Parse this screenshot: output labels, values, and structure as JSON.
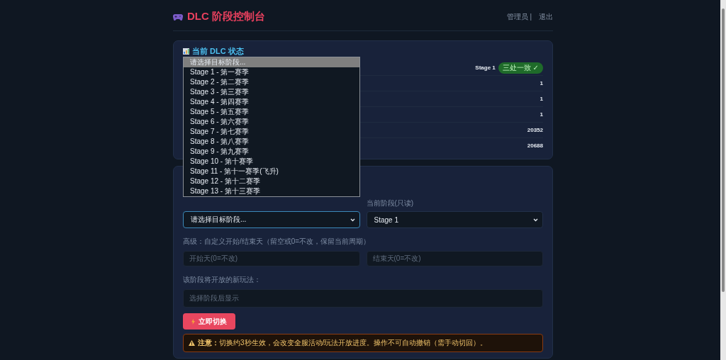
{
  "header": {
    "title": "DLC 阶段控制台",
    "user": "管理员 |",
    "logout": "退出"
  },
  "status_card": {
    "title": "当前 DLC 状态",
    "stage": "Stage 1",
    "badge": "三处一致 ✓",
    "values": [
      "1",
      "1",
      "1",
      "20352",
      "20688"
    ]
  },
  "switch_card": {
    "target_select": {
      "value": "请选择目标阶段...",
      "expanded": true,
      "options": [
        {
          "label": "请选择目标阶段...",
          "selected": true
        },
        {
          "label": "Stage 1 - 第一赛季",
          "selected": false
        },
        {
          "label": "Stage 2 - 第二赛季",
          "selected": false
        },
        {
          "label": "Stage 3 - 第三赛季",
          "selected": false
        },
        {
          "label": "Stage 4 - 第四赛季",
          "selected": false
        },
        {
          "label": "Stage 5 - 第五赛季",
          "selected": false
        },
        {
          "label": "Stage 6 - 第六赛季",
          "selected": false
        },
        {
          "label": "Stage 7 - 第七赛季",
          "selected": false
        },
        {
          "label": "Stage 8 - 第八赛季",
          "selected": false
        },
        {
          "label": "Stage 9 - 第九赛季",
          "selected": false
        },
        {
          "label": "Stage 10 - 第十赛季",
          "selected": false
        },
        {
          "label": "Stage 11 - 第十一赛季(飞升)",
          "selected": false
        },
        {
          "label": "Stage 12 - 第十二赛季",
          "selected": false
        },
        {
          "label": "Stage 13 - 第十三赛季",
          "selected": false
        }
      ]
    },
    "current_label": "当前阶段(只读)",
    "current_value": "Stage 1",
    "advanced_label": "高级：自定义开始/结束天（留空或0=不改，保留当前周期）",
    "start_placeholder": "开始天(0=不改)",
    "end_placeholder": "结束天(0=不改)",
    "features_label": "该阶段将开放的新玩法：",
    "features_placeholder": "选择阶段后显示",
    "button": "立即切换",
    "warning": "**注意：**切换约3秒生效，会改变全服活动/玩法开放进度。操作不可自动撤销（需手动切回）。"
  }
}
